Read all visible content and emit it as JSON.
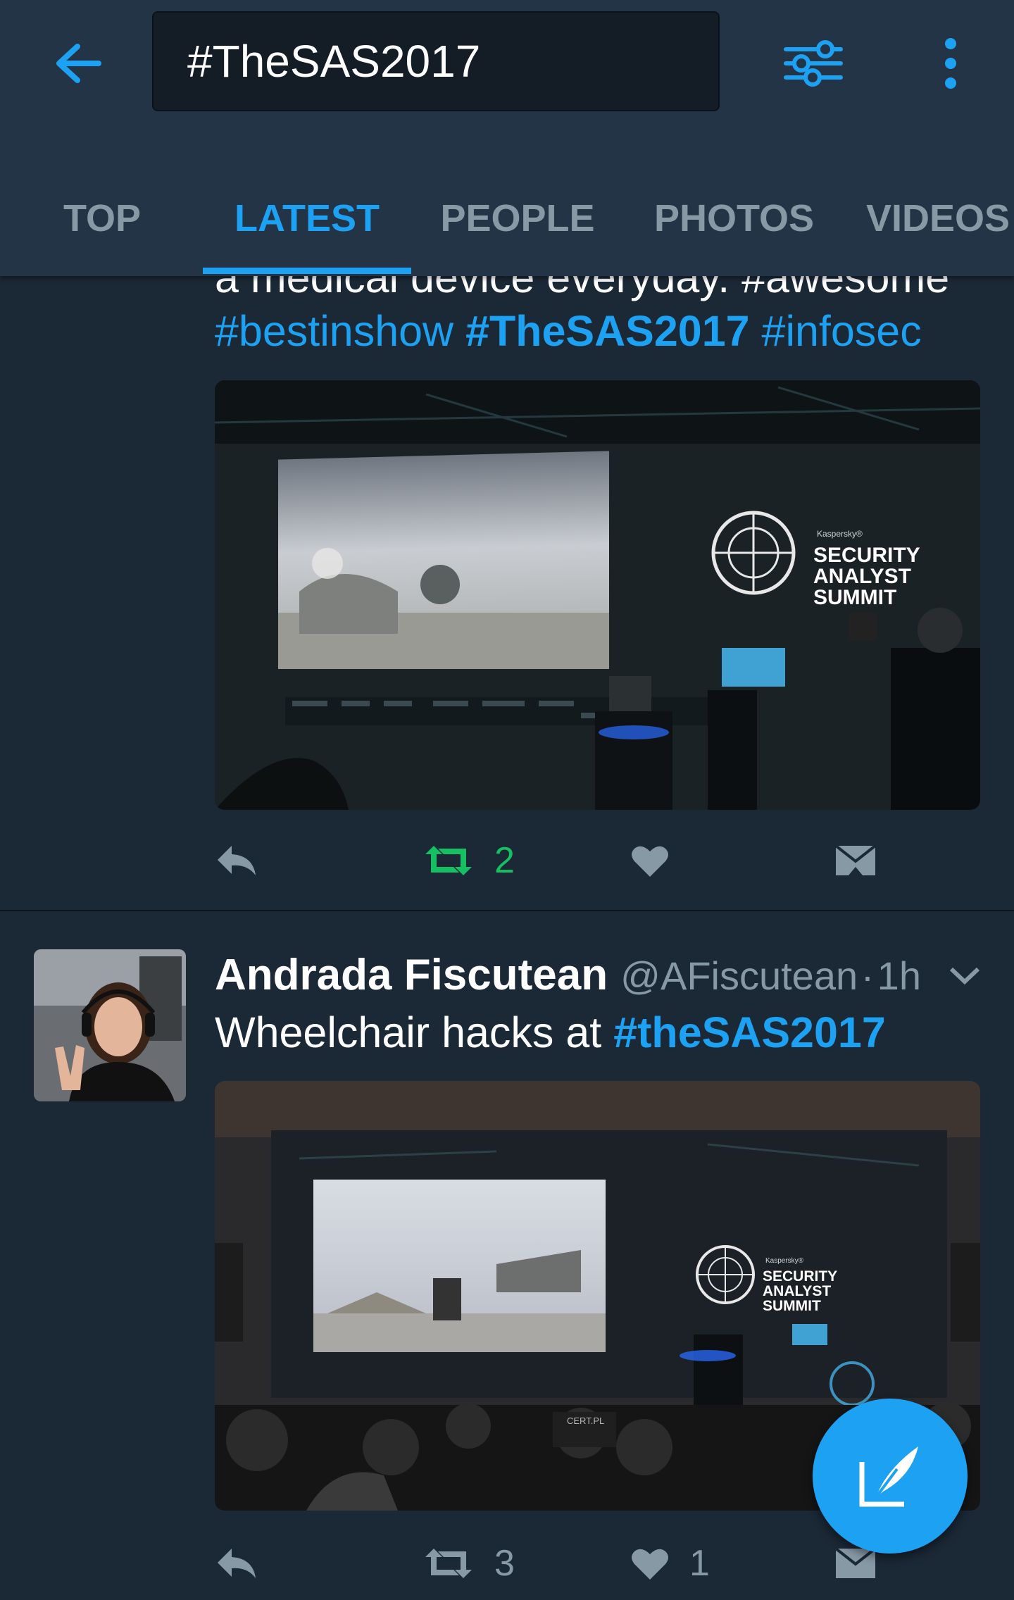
{
  "header": {
    "search_value": "#TheSAS2017",
    "tabs": [
      {
        "label": "TOP"
      },
      {
        "label": "LATEST"
      },
      {
        "label": "PEOPLE"
      },
      {
        "label": "PHOTOS"
      },
      {
        "label": "VIDEOS"
      }
    ],
    "active_tab": "LATEST"
  },
  "tweet1": {
    "text_line1": "a medical device everyday. #awesome",
    "tags": [
      "#bestinshow",
      "#TheSAS2017",
      "#infosec"
    ],
    "media": {
      "brand": "Kaspersky®",
      "title_lines": [
        "SECURITY",
        "ANALYST",
        "SUMMIT"
      ]
    },
    "retweets": "2"
  },
  "tweet2": {
    "author_name": "Andrada Fiscutean",
    "author_handle": "@AFiscutean",
    "separator": "·",
    "time": "1h",
    "text": "Wheelchair hacks at ",
    "tag": "#theSAS2017",
    "media": {
      "brand": "Kaspersky®",
      "title_lines": [
        "SECURITY",
        "ANALYST",
        "SUMMIT"
      ],
      "sign": "CERT.PL"
    },
    "retweets": "3",
    "likes": "1"
  },
  "colors": {
    "accent": "#1da1f2",
    "retweet_active": "#17bf63",
    "background": "#1b2836",
    "header": "#243447",
    "muted": "#8899a6"
  },
  "icons": [
    "back-arrow-icon",
    "filter-icon",
    "more-vertical-icon",
    "reply-icon",
    "retweet-icon",
    "heart-icon",
    "direct-message-icon",
    "caret-down-icon",
    "compose-icon"
  ]
}
